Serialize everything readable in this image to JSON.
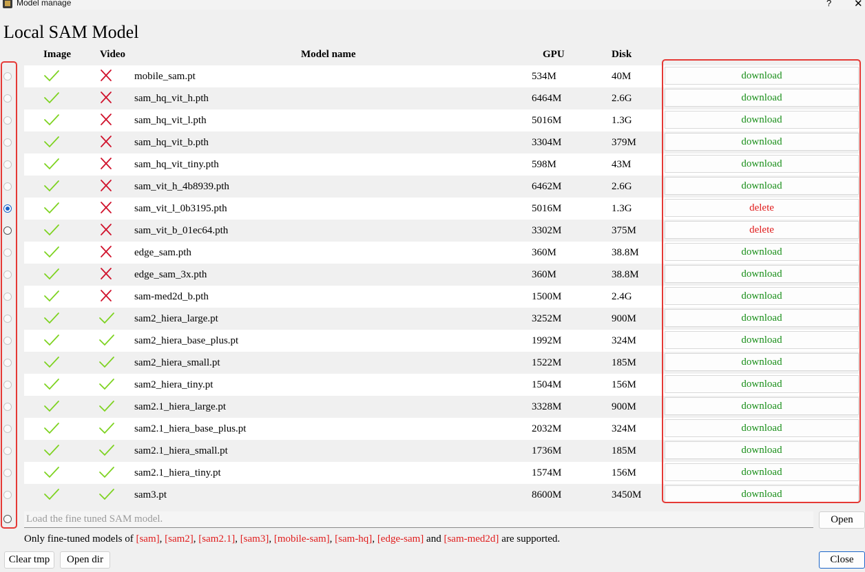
{
  "window": {
    "title": "Model manage",
    "help": "?",
    "close": "✕"
  },
  "heading": "Local SAM Model",
  "columns": {
    "image": "Image",
    "video": "Video",
    "name": "Model name",
    "gpu": "GPU",
    "disk": "Disk"
  },
  "colors": {
    "check": "#7ed321",
    "cross": "#d0112b",
    "download": "#1a8f1a",
    "delete": "#e01b1b",
    "highlight": "#e53935"
  },
  "selected_row": 6,
  "rows": [
    {
      "name": "mobile_sam.pt",
      "image": true,
      "video": false,
      "gpu": "534M",
      "disk": "40M",
      "action": "download"
    },
    {
      "name": "sam_hq_vit_h.pth",
      "image": true,
      "video": false,
      "gpu": "6464M",
      "disk": "2.6G",
      "action": "download"
    },
    {
      "name": "sam_hq_vit_l.pth",
      "image": true,
      "video": false,
      "gpu": "5016M",
      "disk": "1.3G",
      "action": "download"
    },
    {
      "name": "sam_hq_vit_b.pth",
      "image": true,
      "video": false,
      "gpu": "3304M",
      "disk": "379M",
      "action": "download"
    },
    {
      "name": "sam_hq_vit_tiny.pth",
      "image": true,
      "video": false,
      "gpu": "598M",
      "disk": "43M",
      "action": "download"
    },
    {
      "name": "sam_vit_h_4b8939.pth",
      "image": true,
      "video": false,
      "gpu": "6462M",
      "disk": "2.6G",
      "action": "download"
    },
    {
      "name": "sam_vit_l_0b3195.pth",
      "image": true,
      "video": false,
      "gpu": "5016M",
      "disk": "1.3G",
      "action": "delete"
    },
    {
      "name": "sam_vit_b_01ec64.pth",
      "image": true,
      "video": false,
      "gpu": "3302M",
      "disk": "375M",
      "action": "delete"
    },
    {
      "name": "edge_sam.pth",
      "image": true,
      "video": false,
      "gpu": "360M",
      "disk": "38.8M",
      "action": "download"
    },
    {
      "name": "edge_sam_3x.pth",
      "image": true,
      "video": false,
      "gpu": "360M",
      "disk": "38.8M",
      "action": "download"
    },
    {
      "name": "sam-med2d_b.pth",
      "image": true,
      "video": false,
      "gpu": "1500M",
      "disk": "2.4G",
      "action": "download"
    },
    {
      "name": "sam2_hiera_large.pt",
      "image": true,
      "video": true,
      "gpu": "3252M",
      "disk": "900M",
      "action": "download"
    },
    {
      "name": "sam2_hiera_base_plus.pt",
      "image": true,
      "video": true,
      "gpu": "1992M",
      "disk": "324M",
      "action": "download"
    },
    {
      "name": "sam2_hiera_small.pt",
      "image": true,
      "video": true,
      "gpu": "1522M",
      "disk": "185M",
      "action": "download"
    },
    {
      "name": "sam2_hiera_tiny.pt",
      "image": true,
      "video": true,
      "gpu": "1504M",
      "disk": "156M",
      "action": "download"
    },
    {
      "name": "sam2.1_hiera_large.pt",
      "image": true,
      "video": true,
      "gpu": "3328M",
      "disk": "900M",
      "action": "download"
    },
    {
      "name": "sam2.1_hiera_base_plus.pt",
      "image": true,
      "video": true,
      "gpu": "2032M",
      "disk": "324M",
      "action": "download"
    },
    {
      "name": "sam2.1_hiera_small.pt",
      "image": true,
      "video": true,
      "gpu": "1736M",
      "disk": "185M",
      "action": "download"
    },
    {
      "name": "sam2.1_hiera_tiny.pt",
      "image": true,
      "video": true,
      "gpu": "1574M",
      "disk": "156M",
      "action": "download"
    },
    {
      "name": "sam3.pt",
      "image": true,
      "video": true,
      "gpu": "8600M",
      "disk": "3450M",
      "action": "download"
    }
  ],
  "fine_tuned": {
    "placeholder": "Load the fine tuned SAM model.",
    "value": "",
    "open_label": "Open"
  },
  "support_note": {
    "prefix": "Only fine-tuned models of ",
    "models": [
      "[sam]",
      "[sam2]",
      "[sam2.1]",
      "[sam3]",
      "[mobile-sam]",
      "[sam-hq]",
      "[edge-sam]",
      "[sam-med2d]"
    ],
    "separator": ", ",
    "conjunction": " and ",
    "suffix": " are supported."
  },
  "footer": {
    "clear_tmp": "Clear tmp",
    "open_dir": "Open dir",
    "close": "Close"
  }
}
